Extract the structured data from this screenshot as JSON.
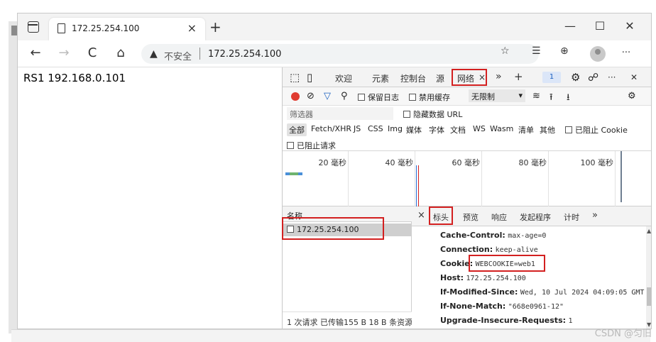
{
  "tab": {
    "title": "172.25.254.100",
    "close": "×",
    "new_tab": "+"
  },
  "window_controls": {
    "minimize": "—",
    "maximize": "☐",
    "close": "✕"
  },
  "navbar": {
    "back": "←",
    "forward": "→",
    "refresh": "C",
    "home": "⌂",
    "warning_icon": "▲",
    "security_text": "不安全",
    "url": "172.25.254.100",
    "more": "···"
  },
  "page": {
    "text": "RS1 192.168.0.101"
  },
  "devtools": {
    "toolbar": {
      "welcome": "欢迎",
      "elements": "元素",
      "console": "控制台",
      "sources": "源",
      "network": "网络",
      "network_close": "×",
      "more_tabs": "»",
      "add": "+",
      "issues_count": "1",
      "more": "···",
      "close": "✕"
    },
    "network_toolbar": {
      "preserve_log": "保留日志",
      "disable_cache": "禁用缓存",
      "throttle": "无限制"
    },
    "filter": {
      "placeholder": "筛选器",
      "hide_data_urls": "隐藏数据 URL"
    },
    "types": [
      "全部",
      "Fetch/XHR",
      "JS",
      "CSS",
      "Img",
      "媒体",
      "字体",
      "文档",
      "WS",
      "Wasm",
      "清单",
      "其他"
    ],
    "blocked_cookies": "已阻止 Cookie",
    "blocked_requests": "已阻止请求",
    "timeline_labels": [
      "20 毫秒",
      "40 毫秒",
      "60 毫秒",
      "80 毫秒",
      "100 毫秒"
    ],
    "request_list": {
      "header": "名称",
      "rows": [
        "172.25.254.100"
      ],
      "footer": "1 次请求  已传输155 B  18 B 条资源"
    },
    "details": {
      "close": "×",
      "tabs": [
        "标头",
        "预览",
        "响应",
        "发起程序",
        "计时"
      ],
      "more": "»",
      "headers": [
        {
          "name": "Cache-Control:",
          "value": "max-age=0"
        },
        {
          "name": "Connection:",
          "value": "keep-alive"
        },
        {
          "name": "Cookie:",
          "value": "WEBCOOKIE=web1"
        },
        {
          "name": "Host:",
          "value": "172.25.254.100"
        },
        {
          "name": "If-Modified-Since:",
          "value": "Wed, 10 Jul 2024 04:09:05 GMT"
        },
        {
          "name": "If-None-Match:",
          "value": "\"668e0961-12\""
        },
        {
          "name": "Upgrade-Insecure-Requests:",
          "value": "1"
        }
      ]
    }
  },
  "watermark": "CSDN @匀旧",
  "colors": {
    "highlight": "#d32020",
    "record": "#e03c31",
    "accent": "#1a5fbf"
  }
}
